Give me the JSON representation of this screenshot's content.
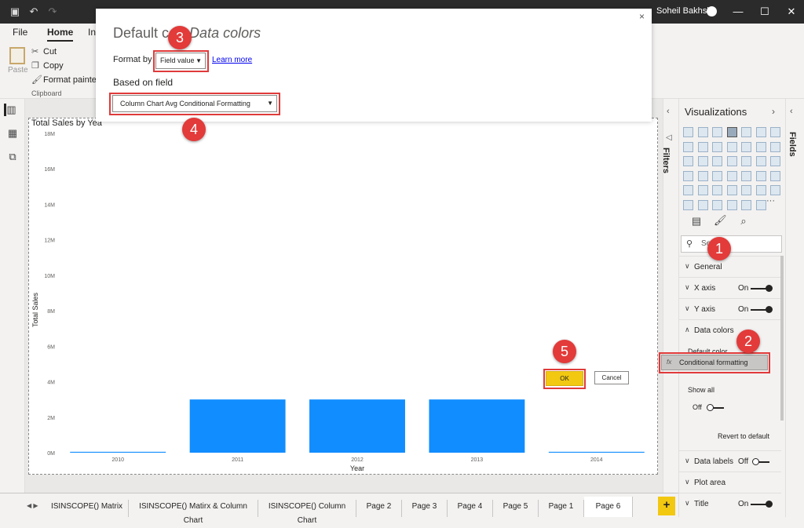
{
  "titlebar": {
    "user": "Soheil Bakhshi",
    "minimize": "—",
    "maximize": "☐",
    "close": "✕"
  },
  "ribbon": {
    "tabs": [
      "File",
      "Home",
      "Ins"
    ],
    "paste": "Paste",
    "cut": "Cut",
    "copy": "Copy",
    "format_painter": "Format painter",
    "clipboard_group": "Clipboard"
  },
  "dialog": {
    "title_main": "Default co",
    "title_sub": "- Data colors",
    "format_by_label": "Format by",
    "format_by_value": "Field value",
    "learn_more": "Learn more",
    "based_on_label": "Based on field",
    "field_value": "Column Chart Avg Conditional Formatting",
    "ok": "OK",
    "cancel": "Cancel",
    "close": "×"
  },
  "annotations": [
    "1",
    "2",
    "3",
    "4",
    "5"
  ],
  "chart_data": {
    "type": "bar",
    "title": "Total Sales by Yea",
    "xlabel": "Year",
    "ylabel": "Total Sales",
    "categories": [
      "2010",
      "2011",
      "2012",
      "2013",
      "2014"
    ],
    "values": [
      0.05,
      3.0,
      3.0,
      3.0,
      0.05
    ],
    "ylim": [
      0,
      18
    ],
    "y_ticks": [
      "0M",
      "2M",
      "4M",
      "6M",
      "8M",
      "10M",
      "12M",
      "14M",
      "16M",
      "18M"
    ],
    "bar_color": "#118dff"
  },
  "filters": {
    "label": "Filters"
  },
  "visualizations": {
    "title": "Visualizations",
    "search_placeholder": "Se",
    "more": "···",
    "sections": {
      "general": "General",
      "x_axis": "X axis",
      "x_axis_state": "On",
      "y_axis": "Y axis",
      "y_axis_state": "On",
      "data_colors": "Data colors",
      "default_color": "Default color",
      "conditional_formatting": "Conditional formatting",
      "fx": "fx",
      "show_all": "Show all",
      "show_all_state": "Off",
      "revert": "Revert to default",
      "data_labels": "Data labels",
      "data_labels_state": "Off",
      "plot_area": "Plot area",
      "title": "Title",
      "title_state": "On"
    }
  },
  "fields": {
    "label": "Fields"
  },
  "pages": {
    "tabs": [
      "ISINSCOPE() Matrix",
      "ISINSCOPE() Matirx & Column Chart",
      "ISINSCOPE() Column Chart",
      "Page 2",
      "Page 3",
      "Page 4",
      "Page 5",
      "Page 1",
      "Page 6"
    ],
    "active": "Page 6",
    "add": "+"
  }
}
